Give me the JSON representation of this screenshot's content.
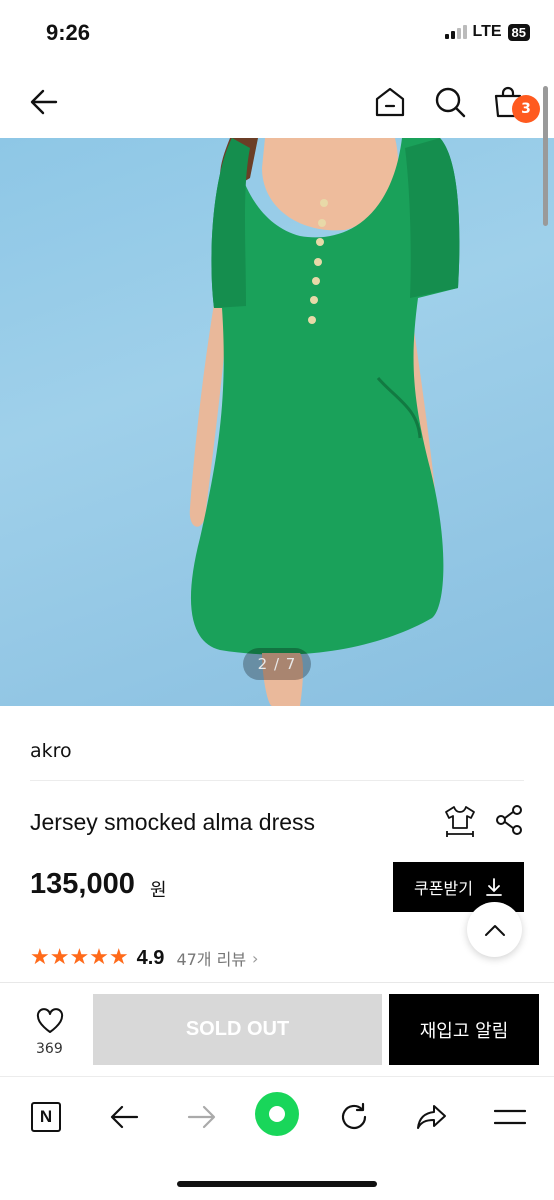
{
  "status": {
    "time": "9:26",
    "network": "LTE",
    "battery": "85"
  },
  "header": {
    "cart_count": "3"
  },
  "image": {
    "counter": "2 / 7"
  },
  "product": {
    "brand": "akro",
    "title": "Jersey smocked alma dress",
    "price": "135,000",
    "price_unit": "원",
    "coupon_label": "쿠폰받기",
    "stars": "★★★★★",
    "rating": "4.9",
    "reviews": "47개 리뷰",
    "reviews_chevron": "›"
  },
  "actions": {
    "like_count": "369",
    "soldout_label": "SOLD OUT",
    "restock_label": "재입고 알림"
  },
  "browser_nav": {
    "n_label": "N"
  },
  "colors": {
    "accent": "#ff5a1f",
    "dress": "#1aa15a",
    "background_blue": "#9fd0ea",
    "button_dark": "#000000",
    "disabled": "#d8d8d8"
  }
}
